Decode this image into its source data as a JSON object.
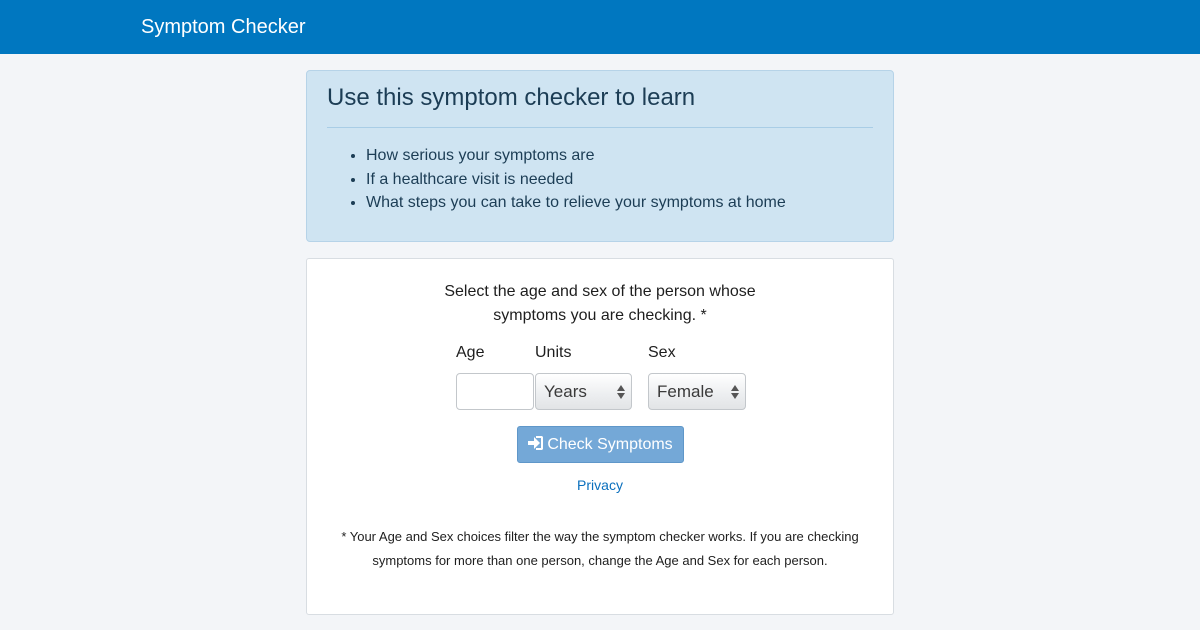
{
  "header": {
    "title": "Symptom Checker",
    "background": "#0077c0"
  },
  "info": {
    "title": "Use this symptom checker to learn",
    "items": [
      "How serious your symptoms are",
      "If a healthcare visit is needed",
      "What steps you can take to relieve your symptoms at home"
    ]
  },
  "form": {
    "prompt_line1": "Select the age and sex of the person whose",
    "prompt_line2": "symptoms you are checking. *",
    "age_label": "Age",
    "age_value": "",
    "units_label": "Units",
    "units_selected": "Years",
    "sex_label": "Sex",
    "sex_selected": "Female",
    "submit_label": "Check Symptoms",
    "submit_icon": "sign-in-icon",
    "privacy_link": "Privacy",
    "footnote_line1": "* Your Age and Sex choices filter the way the symptom checker works. If you are checking",
    "footnote_line2": "symptoms for more than one person, change the Age and Sex for each person."
  }
}
